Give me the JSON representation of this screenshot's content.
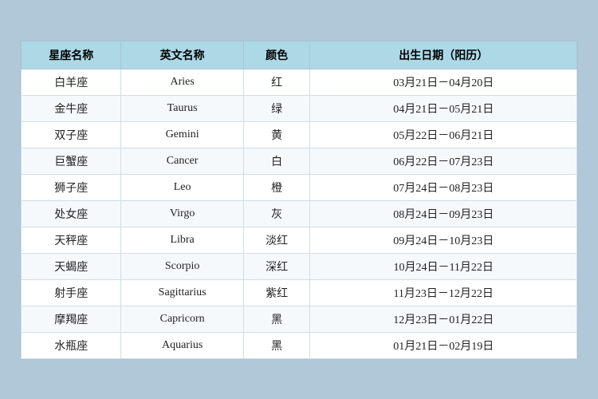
{
  "table": {
    "headers": [
      "星座名称",
      "英文名称",
      "颜色",
      "出生日期（阳历）"
    ],
    "rows": [
      {
        "cn": "白羊座",
        "en": "Aries",
        "color": "红",
        "date": "03月21日－04月20日"
      },
      {
        "cn": "金牛座",
        "en": "Taurus",
        "color": "绿",
        "date": "04月21日－05月21日"
      },
      {
        "cn": "双子座",
        "en": "Gemini",
        "color": "黄",
        "date": "05月22日－06月21日"
      },
      {
        "cn": "巨蟹座",
        "en": "Cancer",
        "color": "白",
        "date": "06月22日－07月23日"
      },
      {
        "cn": "狮子座",
        "en": "Leo",
        "color": "橙",
        "date": "07月24日－08月23日"
      },
      {
        "cn": "处女座",
        "en": "Virgo",
        "color": "灰",
        "date": "08月24日－09月23日"
      },
      {
        "cn": "天秤座",
        "en": "Libra",
        "color": "淡红",
        "date": "09月24日－10月23日"
      },
      {
        "cn": "天蝎座",
        "en": "Scorpio",
        "color": "深红",
        "date": "10月24日－11月22日"
      },
      {
        "cn": "射手座",
        "en": "Sagittarius",
        "color": "紫红",
        "date": "11月23日－12月22日"
      },
      {
        "cn": "摩羯座",
        "en": "Capricorn",
        "color": "黑",
        "date": "12月23日－01月22日"
      },
      {
        "cn": "水瓶座",
        "en": "Aquarius",
        "color": "黑",
        "date": "01月21日－02月19日"
      }
    ]
  }
}
